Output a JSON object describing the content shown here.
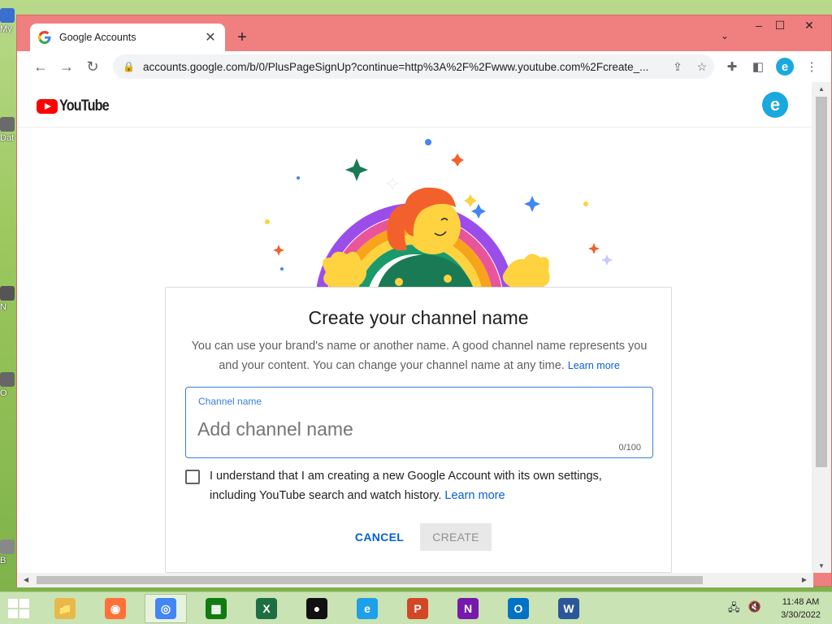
{
  "desktop": {
    "icons": [
      {
        "label": "My"
      },
      {
        "label": "Dat"
      },
      {
        "label": "N"
      },
      {
        "label": "O"
      },
      {
        "label": "B"
      }
    ]
  },
  "browser": {
    "tab": {
      "title": "Google Accounts",
      "close": "✕"
    },
    "new_tab": "+",
    "tab_menu": "⌄",
    "window_controls": {
      "minimize": "–",
      "maximize": "☐",
      "close": "✕"
    },
    "nav": {
      "back": "←",
      "forward": "→",
      "reload": "↻"
    },
    "url": "accounts.google.com/b/0/PlusPageSignUp?continue=http%3A%2F%2Fwww.youtube.com%2Fcreate_...",
    "profile_initial": "e"
  },
  "page": {
    "logo_text": "YouTube",
    "avatar_initial": "e",
    "card": {
      "title": "Create your channel name",
      "description": "You can use your brand's name or another name. A good channel name represents you and your content. You can change your channel name at any time.",
      "description_link": "Learn more",
      "field_label": "Channel name",
      "field_placeholder": "Add channel name",
      "field_value": "",
      "field_count": "0/100",
      "checkbox_text": "I understand that I am creating a new Google Account with its own settings, including YouTube search and watch history.",
      "checkbox_link": "Learn more",
      "checkbox_checked": false,
      "cancel_label": "CANCEL",
      "create_label": "CREATE"
    }
  },
  "taskbar": {
    "apps": [
      {
        "name": "file-explorer",
        "color": "#e8b84a",
        "glyph": "📁"
      },
      {
        "name": "firefox",
        "color": "#ff7139",
        "glyph": "◉"
      },
      {
        "name": "chrome",
        "color": "#4285f4",
        "glyph": "◎"
      },
      {
        "name": "store",
        "color": "#107c10",
        "glyph": "▦"
      },
      {
        "name": "excel",
        "color": "#1d6f42",
        "glyph": "X"
      },
      {
        "name": "recorder",
        "color": "#111111",
        "glyph": "●"
      },
      {
        "name": "internet-explorer",
        "color": "#1ea0e8",
        "glyph": "e"
      },
      {
        "name": "powerpoint",
        "color": "#d24726",
        "glyph": "P"
      },
      {
        "name": "onenote",
        "color": "#7719aa",
        "glyph": "N"
      },
      {
        "name": "outlook",
        "color": "#0072c6",
        "glyph": "O"
      },
      {
        "name": "word",
        "color": "#2b579a",
        "glyph": "W"
      }
    ],
    "time": "11:48 AM",
    "date": "3/30/2022"
  },
  "colors": {
    "window_frame": "#f08080",
    "accent": "#065fd4",
    "youtube_red": "#ff0000"
  }
}
